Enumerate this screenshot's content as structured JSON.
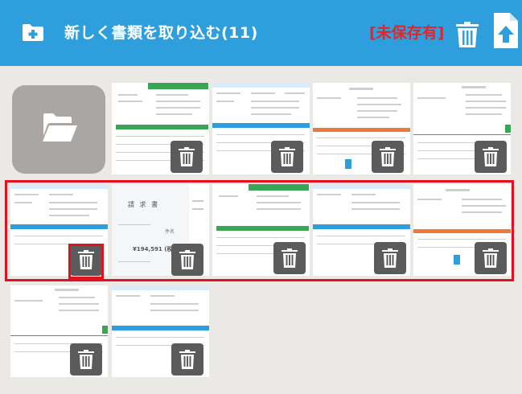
{
  "header": {
    "title": "新しく書類を取り込む(11)",
    "unsaved_label": "[未保存有]",
    "icons": {
      "add": "folder-plus-icon",
      "delete": "trash-icon",
      "upload": "file-upload-icon"
    }
  },
  "colors": {
    "header_bg": "#2e9fdc",
    "unsaved_text": "#e2252b",
    "selection_frame": "#e3101d",
    "trash_button": "#5b5b5b",
    "folder_tile": "#a9a6a3",
    "page_bg": "#ebe9e5"
  },
  "folder_tile": {
    "icon": "folder-open-icon"
  },
  "documents": [
    {
      "kind": "green-header",
      "heading": "納品書・請求書"
    },
    {
      "kind": "blue-header"
    },
    {
      "kind": "blue-header"
    },
    {
      "kind": "orange-header",
      "heading": "納 品 書"
    },
    {
      "kind": "green-stamp",
      "heading": "見 積 書"
    },
    {
      "kind": "blue-header"
    },
    {
      "kind": "invoice-photo",
      "heading": "請 求 書",
      "amount": "¥194,591 (税込)",
      "label": "件名"
    },
    {
      "kind": "green-header",
      "heading": "納品書・請求書"
    },
    {
      "kind": "blue-header"
    },
    {
      "kind": "orange-header",
      "heading": "納 品 書"
    },
    {
      "kind": "green-stamp",
      "heading": "見 積 書"
    },
    {
      "kind": "blue-header"
    }
  ]
}
